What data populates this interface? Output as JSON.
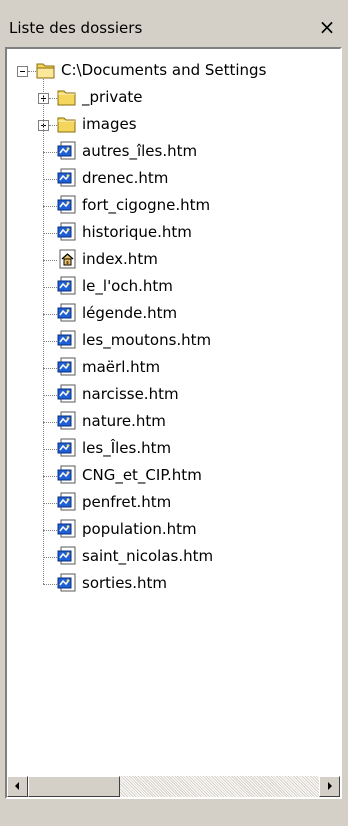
{
  "panel": {
    "title": "Liste des dossiers",
    "close_label": "×"
  },
  "tree": {
    "root": {
      "label": "C:\\Documents and Settings",
      "icon": "folder-open-icon",
      "expander": "minus"
    },
    "folders": [
      {
        "label": "_private",
        "icon": "folder-icon",
        "expander": "plus"
      },
      {
        "label": "images",
        "icon": "folder-icon",
        "expander": "plus"
      }
    ],
    "files": [
      {
        "label": "autres_îles.htm",
        "icon": "html-page-icon"
      },
      {
        "label": "drenec.htm",
        "icon": "html-page-icon"
      },
      {
        "label": "fort_cigogne.htm",
        "icon": "html-page-icon"
      },
      {
        "label": "historique.htm",
        "icon": "html-page-icon"
      },
      {
        "label": "index.htm",
        "icon": "home-page-icon"
      },
      {
        "label": "le_l'och.htm",
        "icon": "html-page-icon"
      },
      {
        "label": "légende.htm",
        "icon": "html-page-icon"
      },
      {
        "label": "les_moutons.htm",
        "icon": "html-page-icon"
      },
      {
        "label": "maërl.htm",
        "icon": "html-page-icon"
      },
      {
        "label": "narcisse.htm",
        "icon": "html-page-icon"
      },
      {
        "label": "nature.htm",
        "icon": "html-page-icon"
      },
      {
        "label": "les_Îles.htm",
        "icon": "html-page-icon"
      },
      {
        "label": "CNG_et_CIP.htm",
        "icon": "html-page-icon"
      },
      {
        "label": "penfret.htm",
        "icon": "html-page-icon"
      },
      {
        "label": "population.htm",
        "icon": "html-page-icon"
      },
      {
        "label": "saint_nicolas.htm",
        "icon": "html-page-icon"
      },
      {
        "label": "sorties.htm",
        "icon": "html-page-icon"
      }
    ]
  },
  "scrollbar": {
    "orientation": "horizontal",
    "position_fraction": 0
  },
  "colors": {
    "panel_bg": "#d4d0c8",
    "tree_bg": "#ffffff",
    "folder_yellow": "#f4d65c",
    "page_blue": "#1f5fd6"
  }
}
